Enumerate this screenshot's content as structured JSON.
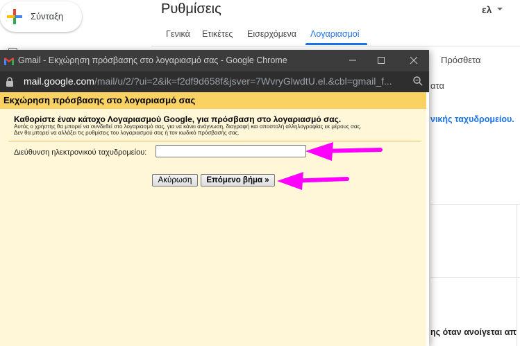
{
  "gmail": {
    "compose_label": "Σύνταξη",
    "settings_title": "Ρυθμίσεις",
    "language": "ελ",
    "tabs": [
      "Γενικά",
      "Ετικέτες",
      "Εισερχόμενα",
      "Λογαριασμοί"
    ],
    "active_tab": "Λογαριασμοί",
    "right_fragments": [
      "Πρόσθετα",
      "ατα",
      "νικής ταχυδρομείου.",
      "ης όταν ανοίγεται απ"
    ]
  },
  "window": {
    "title": "Gmail - Εκχώρηση πρόσβασης στο λογαριασμό σας - Google Chrome",
    "url_domain": "mail.google.com",
    "url_path": "/mail/u/2/?ui=2&ik=f2df9d658f&jsver=7WvryGlwdtU.el.&cbl=gmail_f..."
  },
  "dialog": {
    "header": "Εκχώρηση πρόσβασης στο λογαριασμό σας",
    "intro": "Καθορίστε έναν κάτοχο Λογαριασμού Google, για πρόσβαση στο λογαριασμό σας.",
    "note_line1": "Αυτός ο χρήστης θα μπορεί να συνδεθεί στο λογαριασμό σας, για να κάνει ανάγνωση, διαγραφή και αποστολή αλληλογραφίας εκ μέρους σας.",
    "note_line2": "Δεν θα μπορεί να αλλάξει τις ρυθμίσεις του λογαριασμού σας ή τον κωδικό πρόσβασής σας.",
    "email_label": "Διεύθυνση ηλεκτρονικού ταχυδρομείου:",
    "email_value": "",
    "cancel_button": "Ακύρωση",
    "next_button": "Επόμενο βήμα »"
  },
  "colors": {
    "header_bg": "#fad163",
    "body_bg": "#fff7d7",
    "accent": "#1a73e8",
    "annotation_arrow": "#ff00ff"
  }
}
